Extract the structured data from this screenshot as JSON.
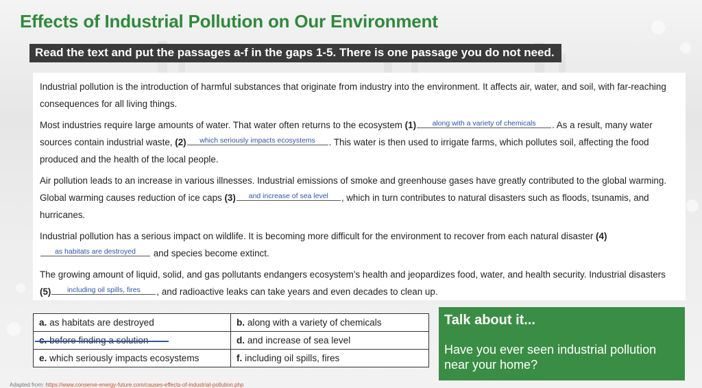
{
  "title": "Effects of Industrial Pollution on Our Environment",
  "instruction": "Read the text and put the passages a-f in the gaps 1-5. There is one passage you do not need.",
  "text": {
    "p1": "Industrial pollution is the introduction of harmful substances that originate from industry into the environment. It affects air, water, and soil, with far-reaching consequences for all living things.",
    "p2a": "Most industries require large amounts of water. That water often returns to the ecosystem ",
    "p2b": ". As a result, many water sources contain industrial waste, ",
    "p2c": ". This water is then used to irrigate farms, which pollutes soil, affecting the food produced and the health of the local people.",
    "p3a": "Air pollution leads to an increase in various illnesses. Industrial emissions of smoke and greenhouse gases have greatly contributed to the global warming. Global warming causes reduction of ice caps ",
    "p3b": ", which in turn contributes to natural disasters such as floods, tsunamis, and hurricanes.",
    "p4a": "Industrial pollution has a serious impact on wildlife. It is becoming more difficult for the environment to recover from each natural disaster ",
    "p4b": " and species become extinct.",
    "p5a": "The growing amount of liquid, solid, and gas pollutants endangers ecosystem’s health and jeopardizes food, water, and health security. Industrial disasters ",
    "p5b": ", and radioactive leaks can take years and even decades to clean up."
  },
  "gaps": [
    {
      "num": "(1)",
      "answer": "along with a variety of chemicals"
    },
    {
      "num": "(2)",
      "answer": "which seriously impacts ecosystems"
    },
    {
      "num": "(3)",
      "answer": "and increase of sea level"
    },
    {
      "num": "(4)",
      "answer": "as habitats are destroyed"
    },
    {
      "num": "(5)",
      "answer": "including oil spills, fires"
    }
  ],
  "options": [
    {
      "letter": "a.",
      "text": "as habitats are destroyed",
      "struck": false
    },
    {
      "letter": "b.",
      "text": "along with a variety of chemicals",
      "struck": false
    },
    {
      "letter": "c.",
      "text": "before finding a solution",
      "struck": true
    },
    {
      "letter": "d.",
      "text": "and increase of sea level",
      "struck": false
    },
    {
      "letter": "e.",
      "text": "which seriously impacts ecosystems",
      "struck": false
    },
    {
      "letter": "f.",
      "text": "including oil spills, fires",
      "struck": false
    }
  ],
  "talk": {
    "heading": "Talk about it...",
    "question": "Have you ever seen industrial pollution near your home?"
  },
  "source": {
    "label": "Adapted from: ",
    "url": "https://www.conserve-energy-future.com/causes-effects-of-industrial-pollution.php"
  },
  "colors": {
    "title_green": "#2f8a3b",
    "box_green": "#3a8d44",
    "answer_blue": "#2a55a8",
    "instruction_bg": "#3a3a3a"
  }
}
